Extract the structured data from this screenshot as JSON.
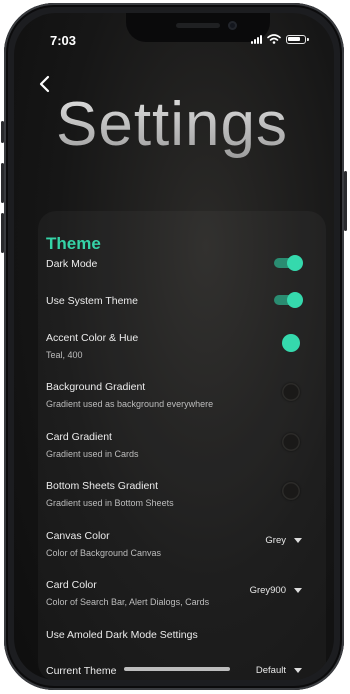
{
  "status": {
    "time": "7:03"
  },
  "page": {
    "title": "Settings"
  },
  "theme": {
    "section_title": "Theme",
    "dark_mode": {
      "label": "Dark Mode",
      "on": true
    },
    "system_theme": {
      "label": "Use System Theme",
      "on": true
    },
    "accent": {
      "label": "Accent Color & Hue",
      "value": "Teal, 400",
      "color": "#35d9ad"
    },
    "background_gradient": {
      "label": "Background Gradient",
      "sub": "Gradient used as background everywhere"
    },
    "card_gradient": {
      "label": "Card Gradient",
      "sub": "Gradient used in Cards"
    },
    "bottom_sheets_gradient": {
      "label": "Bottom Sheets Gradient",
      "sub": "Gradient used in Bottom Sheets"
    },
    "canvas_color": {
      "label": "Canvas Color",
      "sub": "Color of Background Canvas",
      "value": "Grey"
    },
    "card_color": {
      "label": "Card Color",
      "sub": "Color of Search Bar, Alert Dialogs, Cards",
      "value": "Grey900"
    },
    "amoled": {
      "label": "Use Amoled Dark Mode Settings"
    },
    "current_theme": {
      "label": "Current Theme",
      "value": "Default"
    }
  },
  "icons": {
    "back": "chevron-left-icon",
    "signal": "signal-icon",
    "wifi": "wifi-icon",
    "battery": "battery-icon"
  },
  "colors": {
    "accent": "#35d3a7",
    "background": "#161616"
  }
}
